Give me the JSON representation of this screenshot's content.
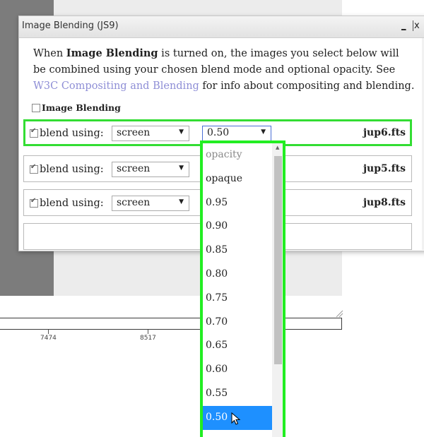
{
  "dialog": {
    "title": "Image Blending (JS9)",
    "minimize_label": "_",
    "close_label": "x",
    "desc_prefix": "When ",
    "desc_bold": "Image Blending",
    "desc_mid": " is turned on, the images you select below will be combined using your chosen blend mode and optional opacity. See ",
    "desc_link": "W3C Compositing and Blending",
    "desc_suffix": " for info about compositing and blending.",
    "image_blending_label": "Image Blending"
  },
  "rows": [
    {
      "blend_label": "blend using:",
      "mode": "screen",
      "opacity": "0.50",
      "file": "jup6.fts"
    },
    {
      "blend_label": "blend using:",
      "mode": "screen",
      "file": "jup5.fts"
    },
    {
      "blend_label": "blend using:",
      "mode": "screen",
      "file": "jup8.fts"
    }
  ],
  "dropdown": {
    "options": [
      "opacity",
      "opaque",
      "0.95",
      "0.90",
      "0.85",
      "0.80",
      "0.75",
      "0.70",
      "0.65",
      "0.60",
      "0.55",
      "0.50"
    ],
    "selected": "0.50"
  },
  "ruler": {
    "tick_labels": [
      "7474",
      "8517"
    ]
  },
  "colors": {
    "highlight": "#33dd33",
    "selected_bg": "#1e90ff",
    "link": "#8e8ed6"
  }
}
